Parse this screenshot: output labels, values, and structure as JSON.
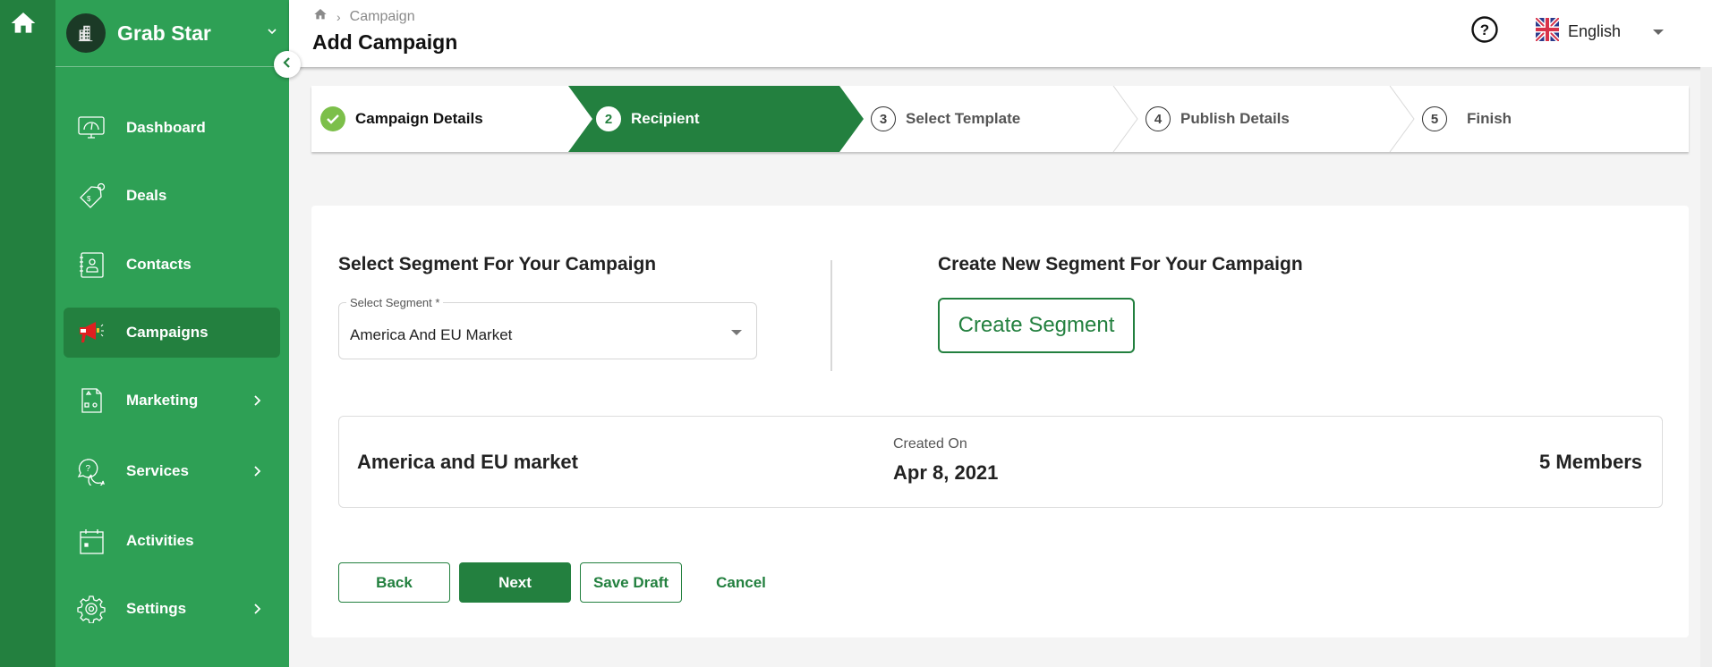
{
  "rail": {
    "home_icon": "home-icon"
  },
  "sidebar": {
    "brand": {
      "name": "Grab Star",
      "logo_icon": "building-icon",
      "chevron_icon": "chevron-down-icon"
    },
    "collapse_icon": "chevron-left-icon",
    "items": [
      {
        "label": "Dashboard",
        "icon": "dashboard-gauge-icon",
        "active": false,
        "has_submenu": false
      },
      {
        "label": "Deals",
        "icon": "price-tag-icon",
        "active": false,
        "has_submenu": false
      },
      {
        "label": "Contacts",
        "icon": "contact-book-icon",
        "active": false,
        "has_submenu": false
      },
      {
        "label": "Campaigns",
        "icon": "megaphone-icon",
        "active": true,
        "has_submenu": false
      },
      {
        "label": "Marketing",
        "icon": "marketing-shapes-icon",
        "active": false,
        "has_submenu": true
      },
      {
        "label": "Services",
        "icon": "chat-question-icon",
        "active": false,
        "has_submenu": true
      },
      {
        "label": "Activities",
        "icon": "calendar-icon",
        "active": false,
        "has_submenu": false
      },
      {
        "label": "Settings",
        "icon": "gear-icon",
        "active": false,
        "has_submenu": true
      }
    ]
  },
  "header": {
    "breadcrumb": {
      "home_icon": "home-icon",
      "separator": "›",
      "current": "Campaign"
    },
    "title": "Add Campaign",
    "help_icon": "help-circle-icon",
    "language": {
      "label": "English",
      "flag_icon": "uk-flag-icon"
    }
  },
  "stepper": {
    "steps": [
      {
        "number": "1",
        "label": "Campaign Details",
        "state": "done"
      },
      {
        "number": "2",
        "label": "Recipient",
        "state": "active"
      },
      {
        "number": "3",
        "label": "Select Template",
        "state": "pending"
      },
      {
        "number": "4",
        "label": "Publish Details",
        "state": "pending"
      },
      {
        "number": "5",
        "label": "Finish",
        "state": "pending"
      }
    ]
  },
  "recipient": {
    "select_title": "Select Segment For Your Campaign",
    "select_label": "Select Segment *",
    "select_value": "America And EU Market",
    "create_title": "Create New Segment For Your Campaign",
    "create_button": "Create Segment",
    "segment": {
      "name": "America and EU market",
      "created_label": "Created On",
      "created_date": "Apr 8, 2021",
      "members": "5 Members"
    }
  },
  "actions": {
    "back": "Back",
    "next": "Next",
    "save_draft": "Save Draft",
    "cancel": "Cancel"
  },
  "colors": {
    "primary": "#23803f",
    "sidebar": "#2ea055",
    "check": "#7cbf4a"
  }
}
